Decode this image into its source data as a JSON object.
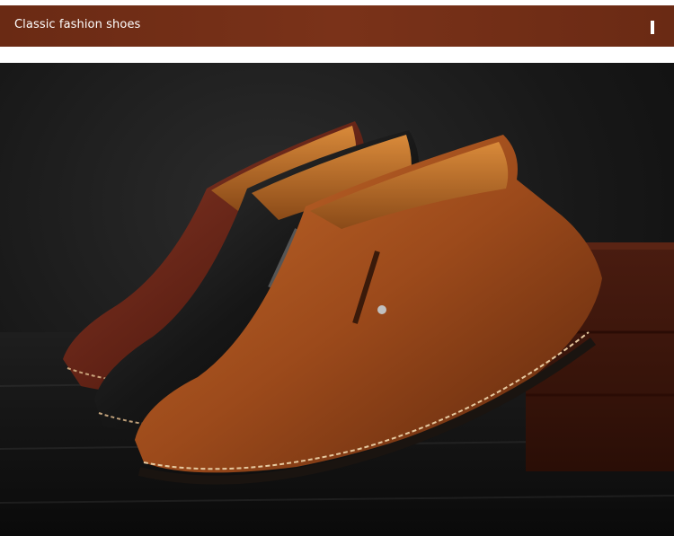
{
  "banner": {
    "title": "Classic fashion shoes",
    "background_color": "#712e16",
    "text_color": "#ffffff",
    "end_marker": "vertical-bar"
  },
  "photo": {
    "subject": "three slip-on leather loafers with side zipper and contrast stitching",
    "shoe_colors": [
      "#5a1e12",
      "#1a1a1a",
      "#a04f1d"
    ],
    "background": "#141414",
    "prop": "wooden-box"
  }
}
